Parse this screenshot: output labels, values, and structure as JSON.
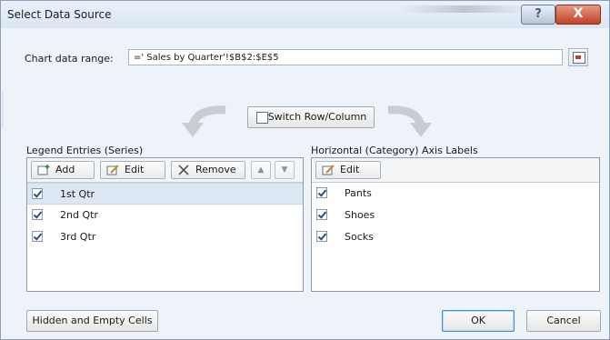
{
  "window": {
    "title": "Select Data Source",
    "help_label": "?",
    "close_label": "X"
  },
  "range": {
    "label": "Chart data range:",
    "value": "=' Sales by Quarter'!$B$2:$E$5"
  },
  "switch": {
    "label": "Switch Row/Column"
  },
  "legend": {
    "label": "Legend Entries (Series)",
    "add_label": "Add",
    "edit_label": "Edit",
    "remove_label": "Remove",
    "items": [
      {
        "label": "1st Qtr",
        "checked": true
      },
      {
        "label": "2nd Qtr",
        "checked": true
      },
      {
        "label": "3rd Qtr",
        "checked": true
      }
    ]
  },
  "axis": {
    "label": "Horizontal (Category) Axis Labels",
    "edit_label": "Edit",
    "items": [
      {
        "label": "Pants",
        "checked": true
      },
      {
        "label": "Shoes",
        "checked": true
      },
      {
        "label": "Socks",
        "checked": true
      }
    ]
  },
  "footer": {
    "hidden_label": "Hidden and Empty Cells",
    "ok_label": "OK",
    "cancel_label": "Cancel"
  }
}
